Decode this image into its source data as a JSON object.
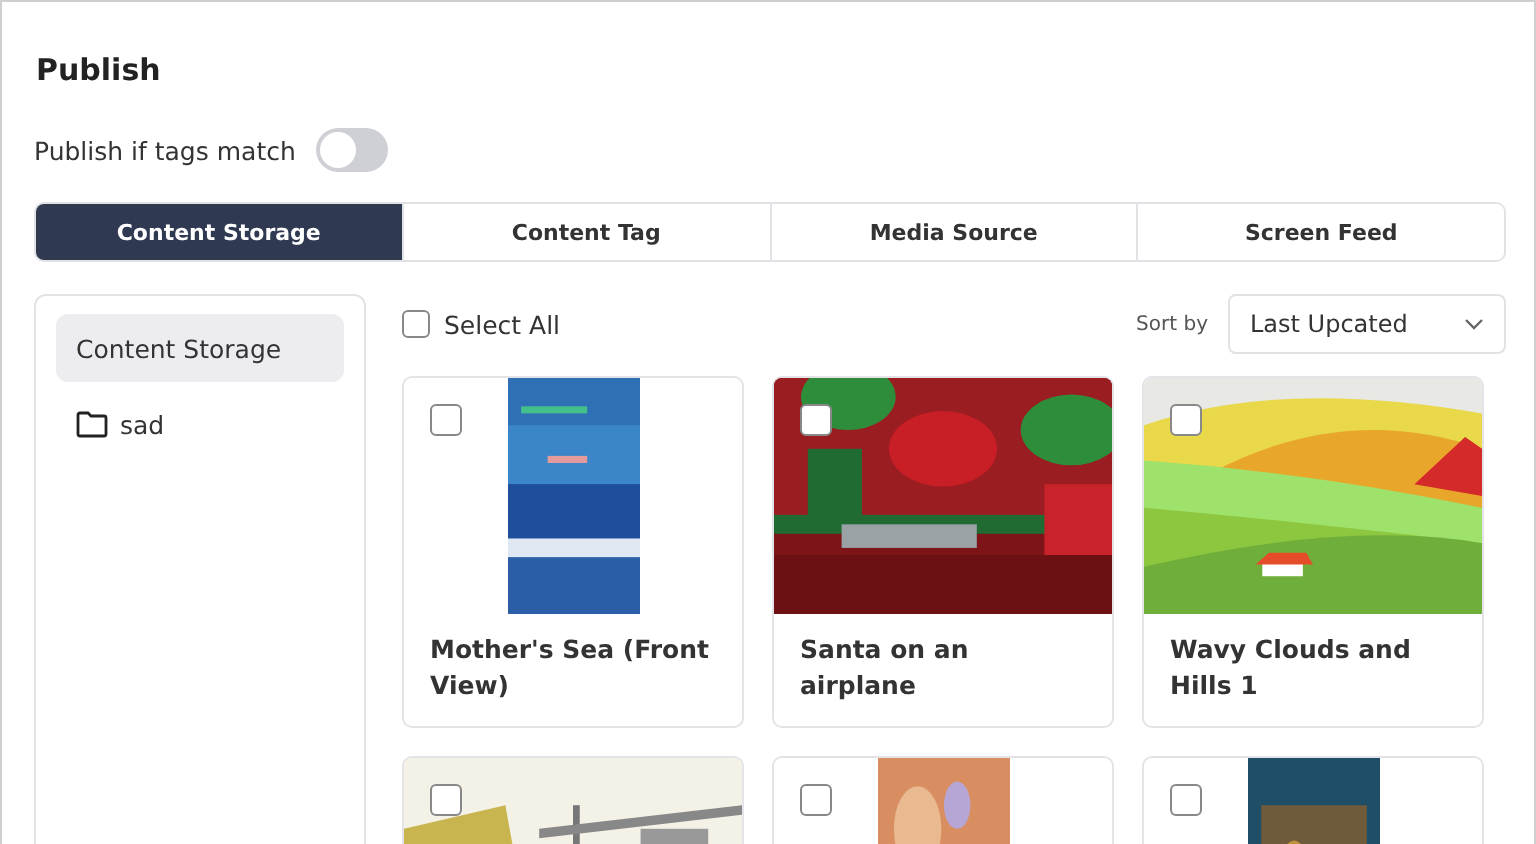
{
  "title": "Publish",
  "toggle": {
    "label": "Publish if tags match",
    "on": false
  },
  "tabs": [
    {
      "label": "Content Storage",
      "selected": true
    },
    {
      "label": "Content Tag",
      "selected": false
    },
    {
      "label": "Media Source",
      "selected": false
    },
    {
      "label": "Screen Feed",
      "selected": false
    }
  ],
  "sidebar": {
    "items": [
      {
        "label": "Content Storage",
        "selected": true,
        "kind": "root"
      },
      {
        "label": "sad",
        "selected": false,
        "kind": "folder"
      }
    ]
  },
  "select_all": {
    "label": "Select All",
    "checked": false
  },
  "sort": {
    "label": "Sort by",
    "value": "Last Upcated"
  },
  "cards": [
    {
      "title": "Mother's Sea (Front View)",
      "checked": false,
      "kind": "portrait"
    },
    {
      "title": "Santa on an airplane",
      "checked": false,
      "kind": "wide"
    },
    {
      "title": "Wavy Clouds and Hills 1",
      "checked": false,
      "kind": "wide"
    },
    {
      "checked": false,
      "kind": "wide"
    },
    {
      "checked": false,
      "kind": "portrait"
    },
    {
      "checked": false,
      "kind": "portrait"
    }
  ]
}
